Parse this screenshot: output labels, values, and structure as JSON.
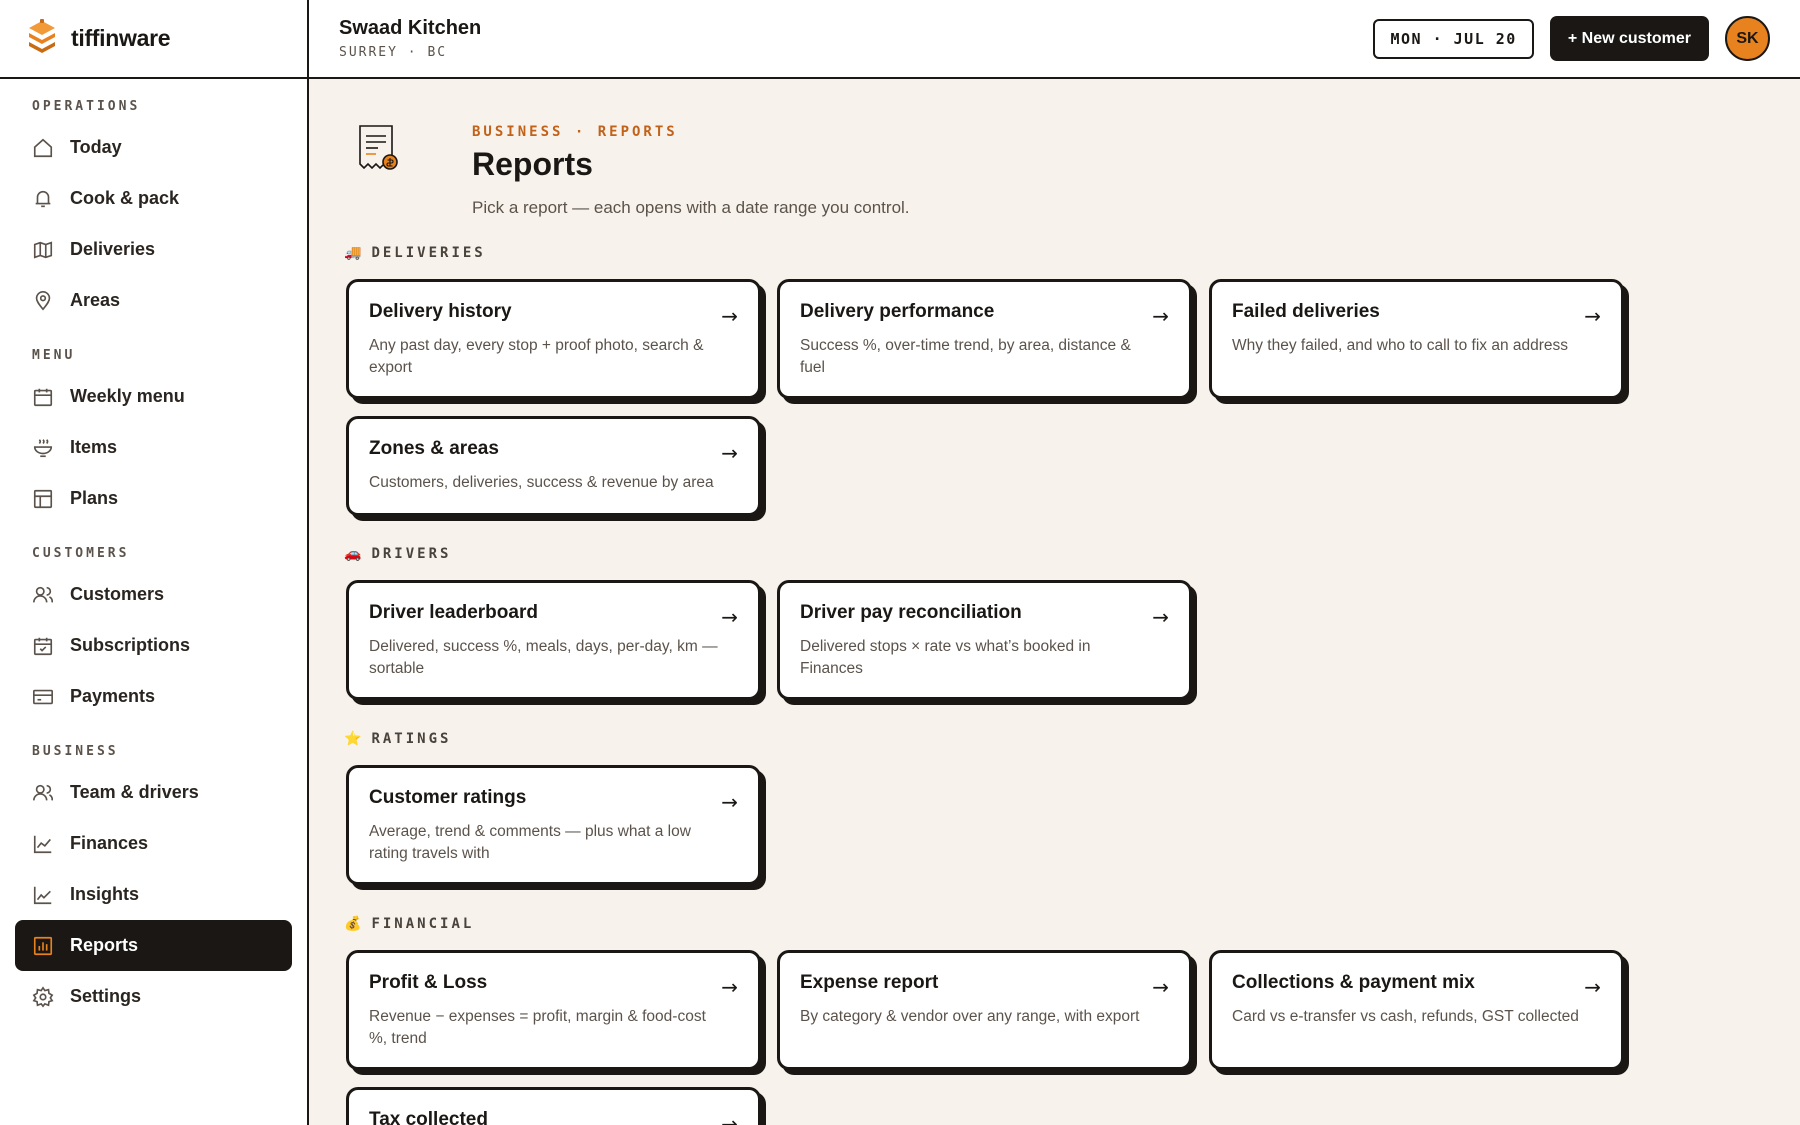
{
  "brand": {
    "name": "tiffinware"
  },
  "header": {
    "business_name": "Swaad Kitchen",
    "location": "SURREY · BC",
    "date": "MON · JUL 20",
    "new_customer_label": "+ New customer",
    "avatar_initials": "SK"
  },
  "sidebar": {
    "sections": {
      "operations": "OPERATIONS",
      "menu": "MENU",
      "customers": "CUSTOMERS",
      "business": "BUSINESS"
    },
    "items": {
      "today": "Today",
      "cook_pack": "Cook & pack",
      "deliveries": "Deliveries",
      "areas": "Areas",
      "weekly_menu": "Weekly menu",
      "items": "Items",
      "plans": "Plans",
      "customers": "Customers",
      "subscriptions": "Subscriptions",
      "payments": "Payments",
      "team_drivers": "Team & drivers",
      "finances": "Finances",
      "insights": "Insights",
      "reports": "Reports",
      "settings": "Settings"
    },
    "active": "reports"
  },
  "page": {
    "breadcrumb": "BUSINESS · REPORTS",
    "title": "Reports",
    "subtitle": "Pick a report — each opens with a date range you control."
  },
  "sections": {
    "deliveries": {
      "icon": "🚚",
      "label": "DELIVERIES"
    },
    "drivers": {
      "icon": "🚗",
      "label": "DRIVERS"
    },
    "ratings": {
      "icon": "⭐",
      "label": "RATINGS"
    },
    "financial": {
      "icon": "💰",
      "label": "FINANCIAL"
    }
  },
  "cards": {
    "delivery_history": {
      "title": "Delivery history",
      "desc": "Any past day, every stop + proof photo, search & export"
    },
    "delivery_performance": {
      "title": "Delivery performance",
      "desc": "Success %, over-time trend, by area, distance & fuel"
    },
    "failed_deliveries": {
      "title": "Failed deliveries",
      "desc": "Why they failed, and who to call to fix an address"
    },
    "zones_areas": {
      "title": "Zones & areas",
      "desc": "Customers, deliveries, success & revenue by area"
    },
    "driver_leaderboard": {
      "title": "Driver leaderboard",
      "desc": "Delivered, success %, meals, days, per-day, km — sortable"
    },
    "driver_pay": {
      "title": "Driver pay reconciliation",
      "desc": "Delivered stops × rate vs what’s booked in Finances"
    },
    "customer_ratings": {
      "title": "Customer ratings",
      "desc": "Average, trend & comments — plus what a low rating travels with"
    },
    "profit_loss": {
      "title": "Profit & Loss",
      "desc": "Revenue − expenses = profit, margin & food-cost %, trend"
    },
    "expense_report": {
      "title": "Expense report",
      "desc": "By category & vendor over any range, with export"
    },
    "collections": {
      "title": "Collections & payment mix",
      "desc": "Card vs e-transfer vs cash, refunds, GST collected"
    },
    "tax_collected": {
      "title": "Tax collected",
      "desc": ""
    }
  },
  "arrow": "→",
  "colors": {
    "accent": "#e8821e",
    "ink": "#1a1714",
    "background": "#f7f3ec",
    "breadcrumb": "#c2621a"
  }
}
